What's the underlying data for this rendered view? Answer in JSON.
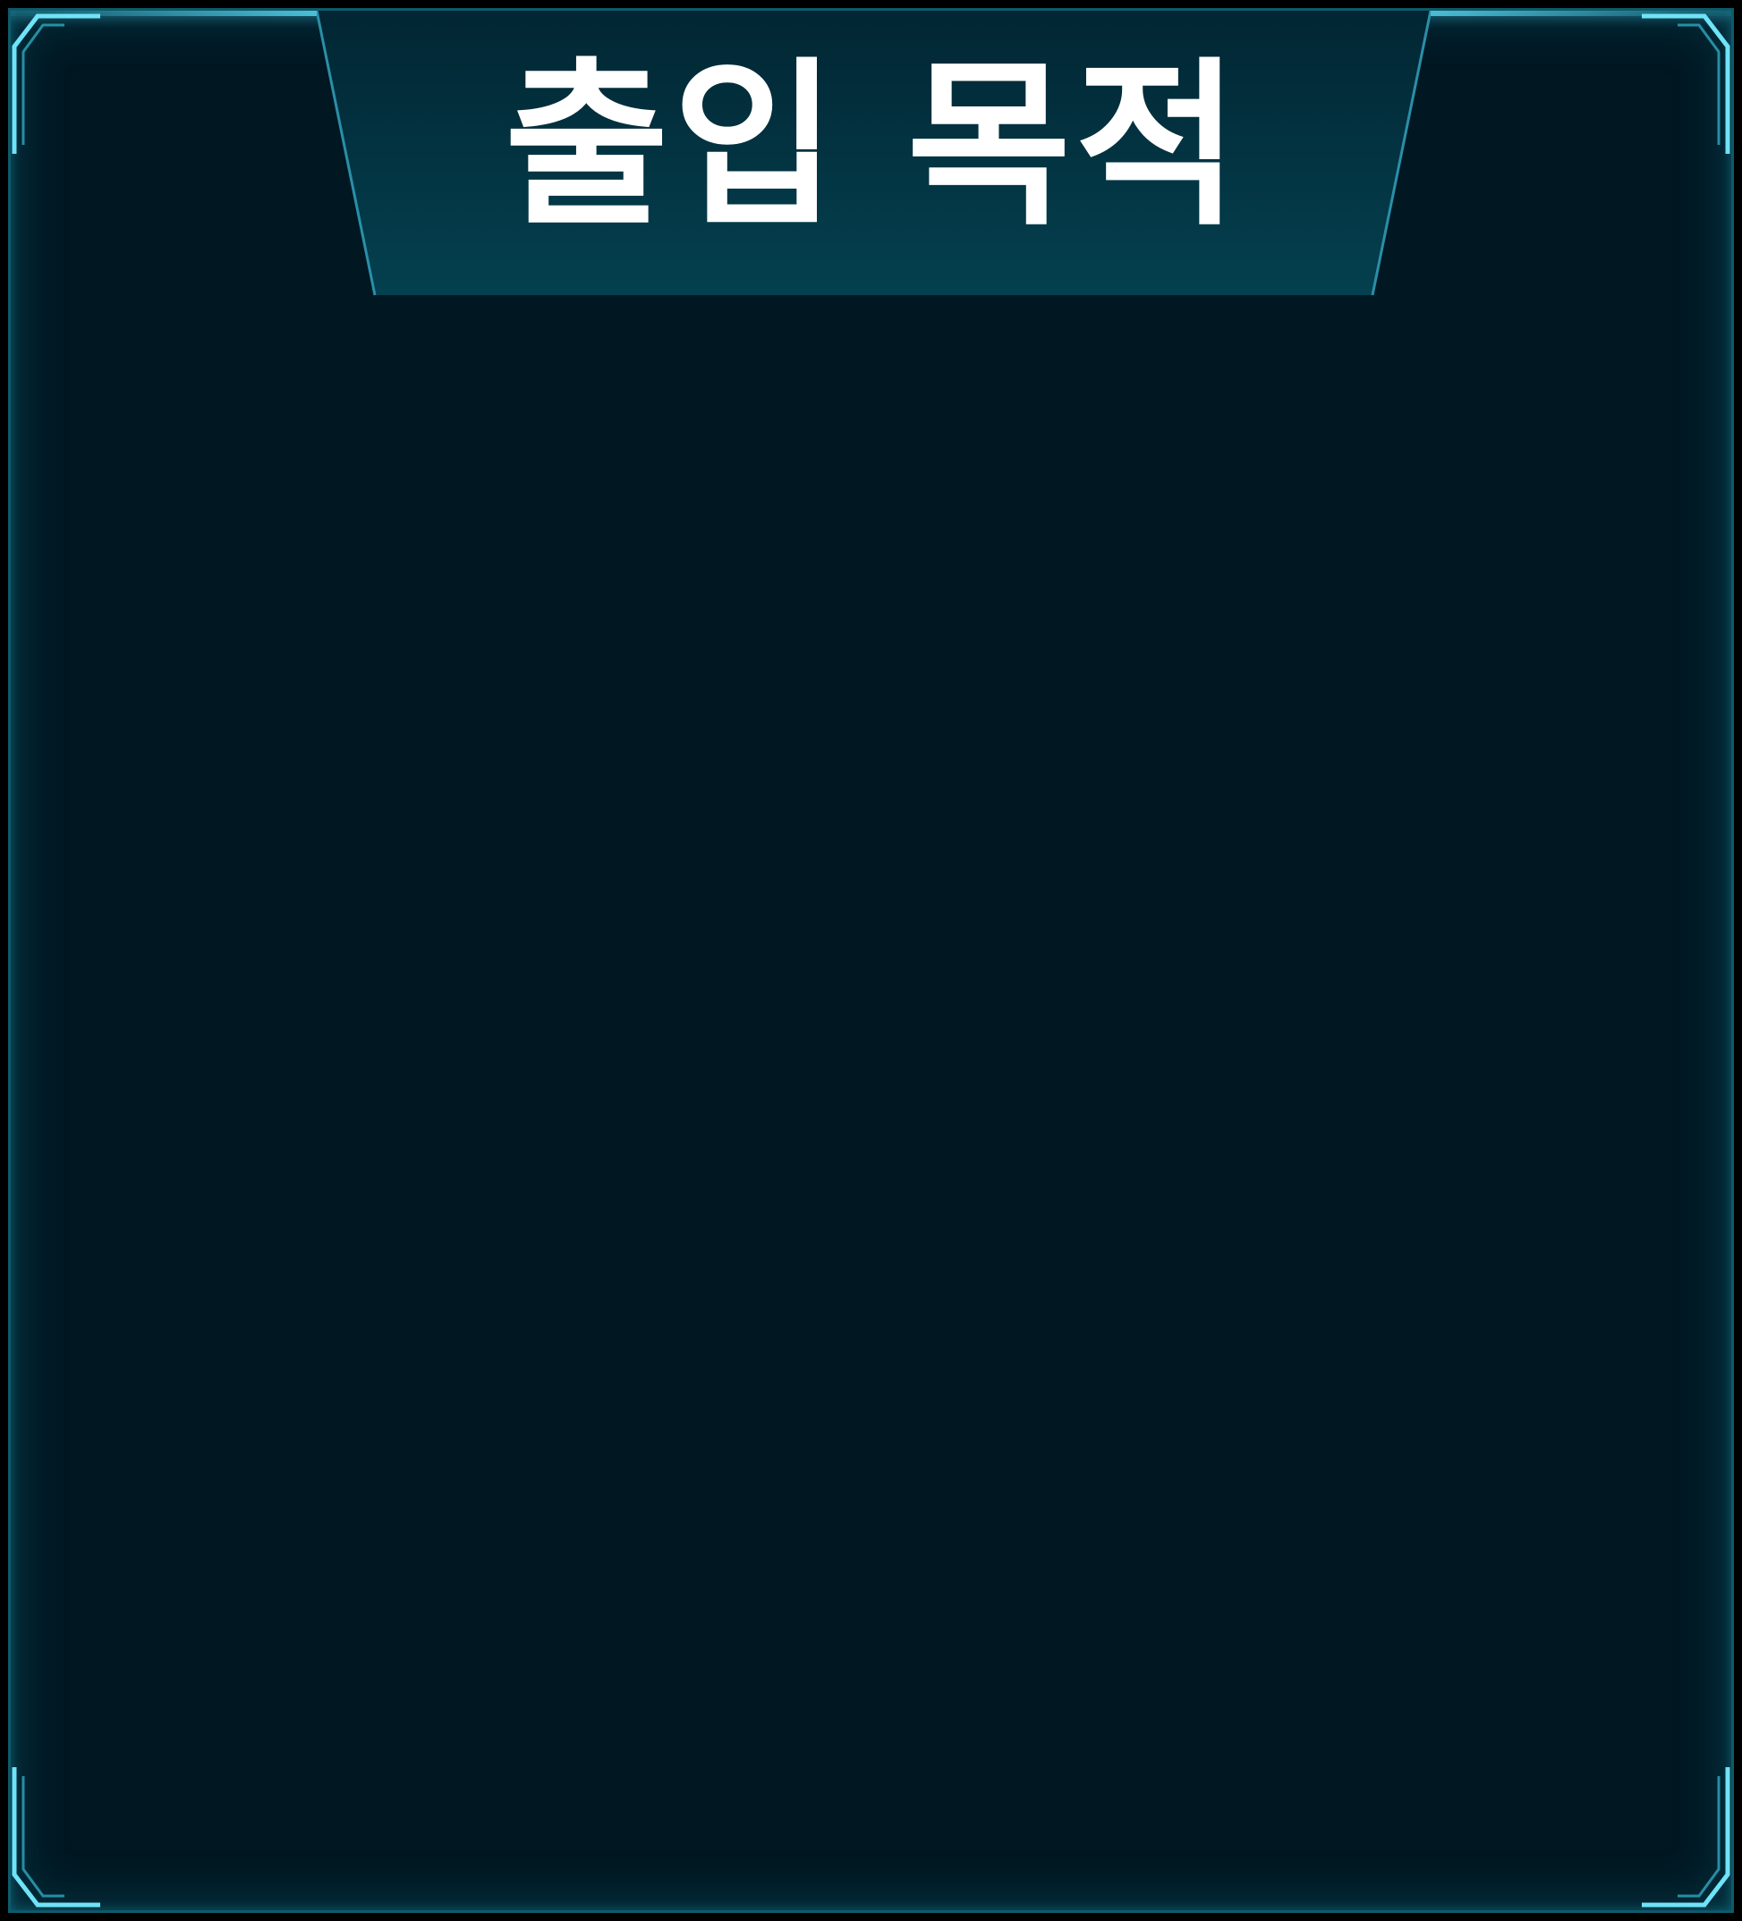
{
  "panel": {
    "title": "출입 목적"
  },
  "theme": {
    "background": "#011822",
    "accent": "#5fd6f0",
    "tab_fill": "#033a4a",
    "title_color": "#ffffff"
  },
  "icons": {
    "corner_top_left": "corner-bracket-icon",
    "corner_top_right": "corner-bracket-icon",
    "corner_bottom_left": "corner-bracket-icon",
    "corner_bottom_right": "corner-bracket-icon"
  }
}
